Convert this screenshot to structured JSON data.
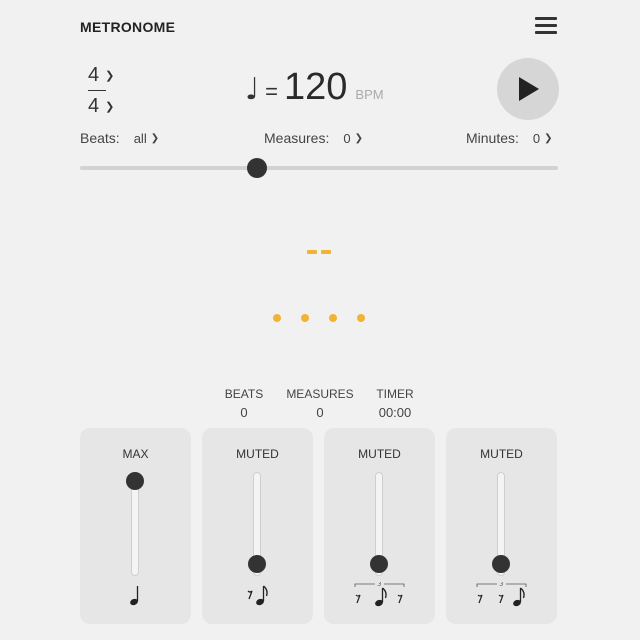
{
  "app": {
    "title": "METRONOME"
  },
  "time_signature": {
    "numerator": "4",
    "denominator": "4"
  },
  "tempo": {
    "equals": "=",
    "bpm": "120",
    "unit": "BPM"
  },
  "selectors": {
    "beats": {
      "label": "Beats:",
      "value": "all"
    },
    "measures": {
      "label": "Measures:",
      "value": "0"
    },
    "minutes": {
      "label": "Minutes:",
      "value": "0"
    }
  },
  "tempo_slider": {
    "level": 0.37
  },
  "stats": {
    "beats": {
      "label": "BEATS",
      "value": "0"
    },
    "measures": {
      "label": "MEASURES",
      "value": "0"
    },
    "timer": {
      "label": "TIMER",
      "value": "00:00"
    }
  },
  "volume_panels": [
    {
      "label": "MAX",
      "level": 1.0,
      "subdivision": "quarter-note"
    },
    {
      "label": "MUTED",
      "level": 0.0,
      "subdivision": "eighth-notes"
    },
    {
      "label": "MUTED",
      "level": 0.0,
      "subdivision": "triplet-middle"
    },
    {
      "label": "MUTED",
      "level": 0.0,
      "subdivision": "triplet-last"
    }
  ],
  "colors": {
    "accent": "#f2b233",
    "background": "#f1f1f1",
    "panel": "#e6e6e6",
    "dark": "#333333"
  },
  "icons": {
    "menu": "hamburger-icon",
    "play": "play-icon",
    "note": "quarter-note-icon"
  },
  "triplet_mark": "3"
}
